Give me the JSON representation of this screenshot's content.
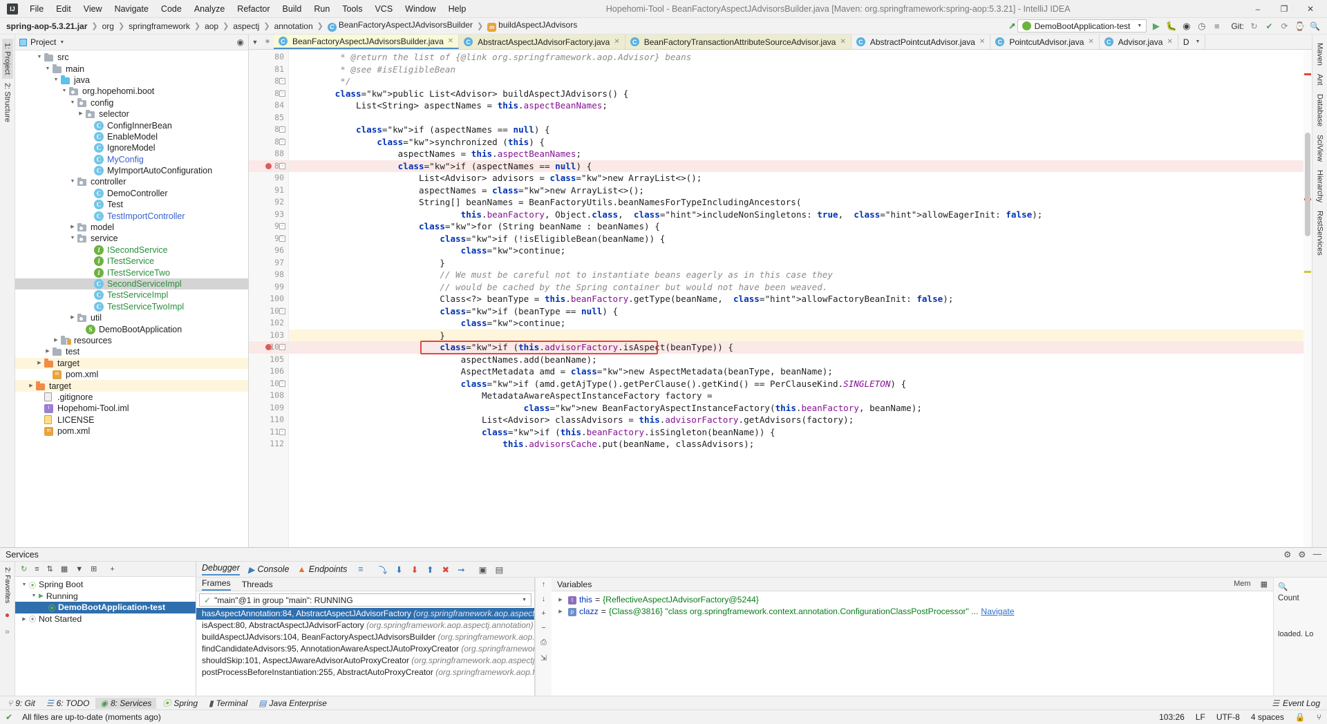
{
  "window": {
    "title": "Hopehomi-Tool - BeanFactoryAspectJAdvisorsBuilder.java [Maven: org.springframework:spring-aop:5.3.21] - IntelliJ IDEA",
    "logo": "IJ",
    "minimize": "–",
    "maximize": "❐",
    "close": "✕"
  },
  "menu": [
    "File",
    "Edit",
    "View",
    "Navigate",
    "Code",
    "Analyze",
    "Refactor",
    "Build",
    "Run",
    "Tools",
    "VCS",
    "Window",
    "Help"
  ],
  "breadcrumbs": [
    {
      "label": "spring-aop-5.3.21.jar",
      "bold": true,
      "icon": null
    },
    {
      "label": "org",
      "icon": null
    },
    {
      "label": "springframework",
      "icon": null
    },
    {
      "label": "aop",
      "icon": null
    },
    {
      "label": "aspectj",
      "icon": null
    },
    {
      "label": "annotation",
      "icon": null
    },
    {
      "label": "BeanFactoryAspectJAdvisorsBuilder",
      "icon": "class-icon"
    },
    {
      "label": "buildAspectJAdvisors",
      "icon": "method-icon"
    }
  ],
  "toolbar": {
    "run_config": "DemoBootApplication-test",
    "run_icon": "run-icon",
    "debug_icon": "debug-icon",
    "run_coverage_icon": "run-with-coverage-icon",
    "profiler_icon": "profiler-icon",
    "stop_icon": "stop-icon",
    "git_label": "Git:",
    "search_icon": "search-icon",
    "hammer_icon": "build-icon",
    "check_icon": "check-icon",
    "update_icon": "update-icon",
    "commit_icon": "commit-icon",
    "history_icon": "history-icon"
  },
  "left_strips": [
    "1: Project",
    "2: Structure"
  ],
  "right_strips": [
    "Maven",
    "Ant",
    "Database",
    "SciView",
    "Hierarchy",
    "RestServices"
  ],
  "project_panel": {
    "title": "Project",
    "locate_icon": "locate-icon",
    "tree": [
      {
        "indent": 2,
        "arrow": "down",
        "icon": "folder",
        "label": "src"
      },
      {
        "indent": 3,
        "arrow": "down",
        "icon": "folder",
        "label": "main"
      },
      {
        "indent": 4,
        "arrow": "down",
        "icon": "folder-blue",
        "label": "java"
      },
      {
        "indent": 5,
        "arrow": "down",
        "icon": "package",
        "label": "org.hopehomi.boot"
      },
      {
        "indent": 6,
        "arrow": "down",
        "icon": "package",
        "label": "config"
      },
      {
        "indent": 7,
        "arrow": "right",
        "icon": "package",
        "label": "selector"
      },
      {
        "indent": 8,
        "arrow": "none",
        "icon": "class",
        "label": "ConfigInnerBean"
      },
      {
        "indent": 8,
        "arrow": "none",
        "icon": "class",
        "label": "EnableModel"
      },
      {
        "indent": 8,
        "arrow": "none",
        "icon": "class",
        "label": "IgnoreModel"
      },
      {
        "indent": 8,
        "arrow": "none",
        "icon": "class",
        "label": "MyConfig",
        "color": "blue"
      },
      {
        "indent": 8,
        "arrow": "none",
        "icon": "class",
        "label": "MyImportAutoConfiguration"
      },
      {
        "indent": 6,
        "arrow": "down",
        "icon": "package",
        "label": "controller"
      },
      {
        "indent": 8,
        "arrow": "none",
        "icon": "class",
        "label": "DemoController"
      },
      {
        "indent": 8,
        "arrow": "none",
        "icon": "class",
        "label": "Test"
      },
      {
        "indent": 8,
        "arrow": "none",
        "icon": "class",
        "label": "TestImportController",
        "color": "blue"
      },
      {
        "indent": 6,
        "arrow": "right",
        "icon": "package",
        "label": "model"
      },
      {
        "indent": 6,
        "arrow": "down",
        "icon": "package",
        "label": "service"
      },
      {
        "indent": 8,
        "arrow": "none",
        "icon": "interface",
        "label": "ISecondService",
        "color": "green"
      },
      {
        "indent": 8,
        "arrow": "none",
        "icon": "interface",
        "label": "ITestService",
        "color": "green"
      },
      {
        "indent": 8,
        "arrow": "none",
        "icon": "interface",
        "label": "ITestServiceTwo",
        "color": "green"
      },
      {
        "indent": 8,
        "arrow": "none",
        "icon": "class",
        "label": "SecondServiceImpl",
        "color": "green",
        "selected": true
      },
      {
        "indent": 8,
        "arrow": "none",
        "icon": "class",
        "label": "TestServiceImpl",
        "color": "green"
      },
      {
        "indent": 8,
        "arrow": "none",
        "icon": "class",
        "label": "TestServiceTwoImpl",
        "color": "green"
      },
      {
        "indent": 6,
        "arrow": "right",
        "icon": "package",
        "label": "util"
      },
      {
        "indent": 7,
        "arrow": "none",
        "icon": "spring-class",
        "label": "DemoBootApplication"
      },
      {
        "indent": 4,
        "arrow": "right",
        "icon": "resources",
        "label": "resources"
      },
      {
        "indent": 3,
        "arrow": "right",
        "icon": "folder",
        "label": "test"
      },
      {
        "indent": 2,
        "arrow": "right",
        "icon": "folder-orange",
        "label": "target",
        "highlight": true
      },
      {
        "indent": 3,
        "arrow": "none",
        "icon": "xml",
        "label": "pom.xml"
      },
      {
        "indent": 1,
        "arrow": "right",
        "icon": "folder-orange",
        "label": "target",
        "highlight": true
      },
      {
        "indent": 2,
        "arrow": "none",
        "icon": "file",
        "label": ".gitignore"
      },
      {
        "indent": 2,
        "arrow": "none",
        "icon": "iml",
        "label": "Hopehomi-Tool.iml"
      },
      {
        "indent": 2,
        "arrow": "none",
        "icon": "license",
        "label": "LICENSE"
      },
      {
        "indent": 2,
        "arrow": "none",
        "icon": "xml",
        "label": "pom.xml"
      }
    ]
  },
  "editor": {
    "tabs": [
      {
        "label": "BeanFactoryAspectJAdvisorsBuilder.java",
        "active": true
      },
      {
        "label": "AbstractAspectJAdvisorFactory.java",
        "active": false
      },
      {
        "label": "BeanFactoryTransactionAttributeSourceAdvisor.java",
        "active": false
      },
      {
        "label": "AbstractPointcutAdvisor.java",
        "active": false
      },
      {
        "label": "PointcutAdvisor.java",
        "active": false
      },
      {
        "label": "Advisor.java",
        "active": false
      }
    ],
    "tabs_overflow": "D",
    "first_line": 80,
    "lines": [
      {
        "n": 80,
        "fold": false,
        "bp": false,
        "hl": false,
        "partial": true,
        "html": "         * @return the list of {@link org.springframework.aop.Advisor} beans"
      },
      {
        "n": 81,
        "fold": false,
        "bp": false,
        "hl": false,
        "html": "         * @see #isEligibleBean"
      },
      {
        "n": 82,
        "fold": true,
        "bp": false,
        "hl": false,
        "html": "         */"
      },
      {
        "n": 83,
        "fold": true,
        "bp": false,
        "hl": false,
        "html": "        public List<Advisor> buildAspectJAdvisors() {"
      },
      {
        "n": 84,
        "fold": false,
        "bp": false,
        "hl": false,
        "html": "            List<String> aspectNames = this.aspectBeanNames;"
      },
      {
        "n": 85,
        "fold": false,
        "bp": false,
        "hl": false,
        "html": ""
      },
      {
        "n": 86,
        "fold": true,
        "bp": false,
        "hl": false,
        "html": "            if (aspectNames == null) {"
      },
      {
        "n": 87,
        "fold": true,
        "bp": false,
        "hl": false,
        "html": "                synchronized (this) {"
      },
      {
        "n": 88,
        "fold": false,
        "bp": false,
        "hl": false,
        "html": "                    aspectNames = this.aspectBeanNames;"
      },
      {
        "n": 89,
        "fold": true,
        "bp": true,
        "hl": true,
        "html": "                    if (aspectNames == null) {"
      },
      {
        "n": 90,
        "fold": false,
        "bp": false,
        "hl": false,
        "html": "                        List<Advisor> advisors = new ArrayList<>();"
      },
      {
        "n": 91,
        "fold": false,
        "bp": false,
        "hl": false,
        "html": "                        aspectNames = new ArrayList<>();"
      },
      {
        "n": 92,
        "fold": false,
        "bp": false,
        "hl": false,
        "html": "                        String[] beanNames = BeanFactoryUtils.beanNamesForTypeIncludingAncestors("
      },
      {
        "n": 93,
        "fold": false,
        "bp": false,
        "hl": false,
        "html": "                                this.beanFactory, Object.class,  includeNonSingletons: true,  allowEagerInit: false);"
      },
      {
        "n": 94,
        "fold": true,
        "bp": false,
        "hl": false,
        "html": "                        for (String beanName : beanNames) {"
      },
      {
        "n": 95,
        "fold": true,
        "bp": false,
        "hl": false,
        "html": "                            if (!isEligibleBean(beanName)) {"
      },
      {
        "n": 96,
        "fold": false,
        "bp": false,
        "hl": false,
        "html": "                                continue;"
      },
      {
        "n": 97,
        "fold": false,
        "bp": false,
        "hl": false,
        "html": "                            }"
      },
      {
        "n": 98,
        "fold": false,
        "bp": false,
        "hl": false,
        "html": "                            // We must be careful not to instantiate beans eagerly as in this case they"
      },
      {
        "n": 99,
        "fold": false,
        "bp": false,
        "hl": false,
        "html": "                            // would be cached by the Spring container but would not have been weaved."
      },
      {
        "n": 100,
        "fold": false,
        "bp": false,
        "hl": false,
        "html": "                            Class<?> beanType = this.beanFactory.getType(beanName,  allowFactoryBeanInit: false);"
      },
      {
        "n": 101,
        "fold": true,
        "bp": false,
        "hl": false,
        "html": "                            if (beanType == null) {"
      },
      {
        "n": 102,
        "fold": false,
        "bp": false,
        "hl": false,
        "html": "                                continue;"
      },
      {
        "n": 103,
        "fold": false,
        "bp": false,
        "hl": false,
        "hl2": true,
        "html": "                            }"
      },
      {
        "n": 104,
        "fold": true,
        "bp": true,
        "hl": true,
        "html": "                            if (this.advisorFactory.isAspect(beanType)) {"
      },
      {
        "n": 105,
        "fold": false,
        "bp": false,
        "hl": false,
        "html": "                                aspectNames.add(beanName);"
      },
      {
        "n": 106,
        "fold": false,
        "bp": false,
        "hl": false,
        "html": "                                AspectMetadata amd = new AspectMetadata(beanType, beanName);"
      },
      {
        "n": 107,
        "fold": true,
        "bp": false,
        "hl": false,
        "html": "                                if (amd.getAjType().getPerClause().getKind() == PerClauseKind.SINGLETON) {"
      },
      {
        "n": 108,
        "fold": false,
        "bp": false,
        "hl": false,
        "html": "                                    MetadataAwareAspectInstanceFactory factory ="
      },
      {
        "n": 109,
        "fold": false,
        "bp": false,
        "hl": false,
        "html": "                                            new BeanFactoryAspectInstanceFactory(this.beanFactory, beanName);"
      },
      {
        "n": 110,
        "fold": false,
        "bp": false,
        "hl": false,
        "html": "                                    List<Advisor> classAdvisors = this.advisorFactory.getAdvisors(factory);"
      },
      {
        "n": 111,
        "fold": true,
        "bp": false,
        "hl": false,
        "html": "                                    if (this.beanFactory.isSingleton(beanName)) {"
      },
      {
        "n": 112,
        "fold": false,
        "bp": false,
        "hl": false,
        "html": "                                        this.advisorsCache.put(beanName, classAdvisors);"
      }
    ]
  },
  "services": {
    "title": "Services",
    "header_icons": [
      "settings-icon",
      "gear-icon",
      "minimize-icon"
    ],
    "toolbar_icons": [
      "rerun-icon",
      "collapse-icon",
      "sort-icon",
      "grid-icon",
      "filter-icon",
      "add-tab-icon",
      "add-icon"
    ],
    "tree": [
      {
        "indent": 0,
        "arrow": "down",
        "icon": "spring-icon",
        "label": "Spring Boot"
      },
      {
        "indent": 1,
        "arrow": "down",
        "icon": "run-icon",
        "label": "Running"
      },
      {
        "indent": 2,
        "arrow": "none",
        "icon": "app-icon",
        "label": "DemoBootApplication-test",
        "selected": true
      },
      {
        "indent": 0,
        "arrow": "right",
        "icon": "not-started-icon",
        "label": "Not Started"
      }
    ],
    "debug_tabs": [
      {
        "label": "Debugger",
        "icon": "debugger-icon",
        "active": true
      },
      {
        "label": "Console",
        "icon": "console-icon",
        "active": false
      },
      {
        "label": "Endpoints",
        "icon": "endpoints-icon",
        "active": false
      }
    ],
    "debug_step_icons": [
      "layout-icon",
      "step-over-icon",
      "step-into-icon",
      "force-step-into-icon",
      "step-out-icon",
      "drop-frame-icon",
      "run-to-cursor-icon",
      "evaluate-icon",
      "settings-icon",
      "mute-icon"
    ],
    "frames_tabs": [
      {
        "label": "Frames",
        "active": true
      },
      {
        "label": "Threads",
        "active": false
      }
    ],
    "thread_selector": "\"main\"@1 in group \"main\": RUNNING",
    "frames": [
      {
        "method": "hasAspectAnnotation:84, AbstractAspectJAdvisorFactory",
        "pkg": "(org.springframework.aop.aspectj.annota",
        "selected": true
      },
      {
        "method": "isAspect:80, AbstractAspectJAdvisorFactory",
        "pkg": "(org.springframework.aop.aspectj.annotation)",
        "selected": false
      },
      {
        "method": "buildAspectJAdvisors:104, BeanFactoryAspectJAdvisorsBuilder",
        "pkg": "(org.springframework.aop.aspectj.",
        "selected": false
      },
      {
        "method": "findCandidateAdvisors:95, AnnotationAwareAspectJAutoProxyCreator",
        "pkg": "(org.springframework.aop.a",
        "selected": false
      },
      {
        "method": "shouldSkip:101, AspectJAwareAdvisorAutoProxyCreator",
        "pkg": "(org.springframework.aop.aspectj.autopr",
        "selected": false
      },
      {
        "method": "postProcessBeforeInstantiation:255, AbstractAutoProxyCreator",
        "pkg": "(org.springframework.aop.framew",
        "selected": false
      }
    ],
    "variables_title": "Variables",
    "variables": [
      {
        "icon": "this",
        "name": "this",
        "eq": " = ",
        "value": "{ReflectiveAspectJAdvisorFactory@5244}",
        "link": null
      },
      {
        "icon": "p",
        "name": "clazz",
        "eq": " = ",
        "value": "{Class@3816} \"class org.springframework.context.annotation.ConfigurationClassPostProcessor\" ...",
        "link": "Navigate"
      }
    ],
    "mem_label": "Mem",
    "side_items": [
      "Count",
      "loaded. Lo"
    ]
  },
  "bottom_bar": {
    "items": [
      {
        "label": "9: Git",
        "icon": "git-icon"
      },
      {
        "label": "6: TODO",
        "icon": "todo-icon"
      },
      {
        "label": "8: Services",
        "icon": "services-icon",
        "active": true
      },
      {
        "label": "Spring",
        "icon": "spring-icon"
      },
      {
        "label": "Terminal",
        "icon": "terminal-icon"
      },
      {
        "label": "Java Enterprise",
        "icon": "java-icon"
      }
    ],
    "event_log": "Event Log"
  },
  "status_bar": {
    "message": "All files are up-to-date (moments ago)",
    "position": "103:26",
    "line_sep": "LF",
    "encoding": "UTF-8",
    "indent": "4 spaces",
    "lock_icon": "lock-icon",
    "git_branch_icon": "branch-icon"
  }
}
